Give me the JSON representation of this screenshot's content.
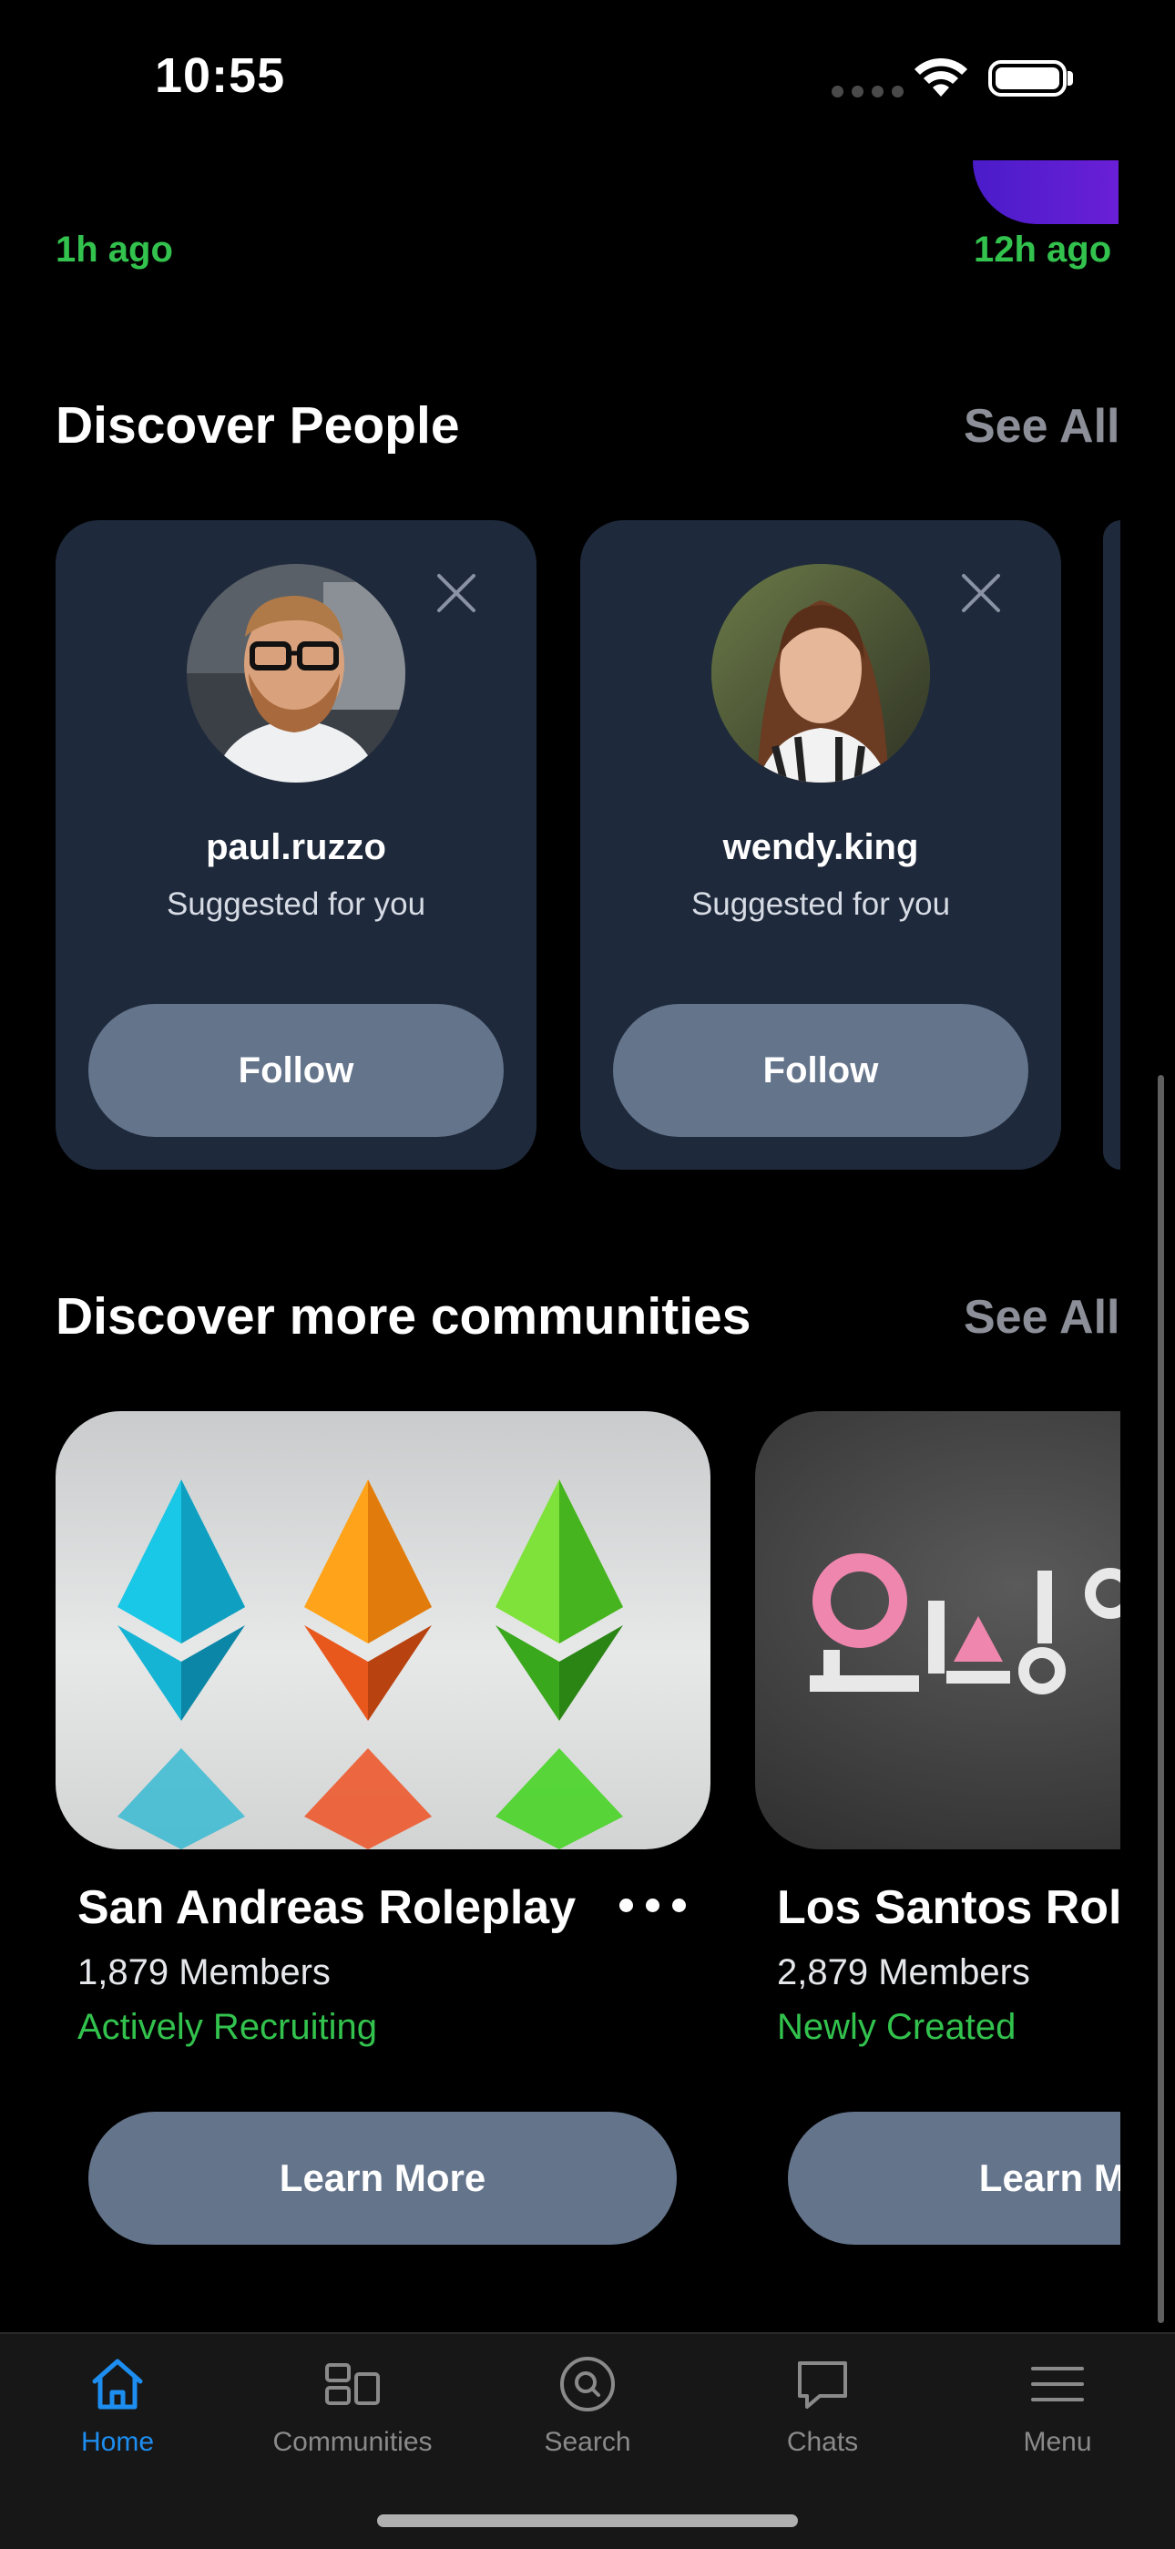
{
  "status_bar": {
    "time": "10:55"
  },
  "feed": {
    "left_time": "1h ago",
    "right_time": "12h ago"
  },
  "discover_people": {
    "title": "Discover People",
    "see_all": "See All",
    "people": [
      {
        "username": "paul.ruzzo",
        "subtitle": "Suggested for you",
        "button": "Follow"
      },
      {
        "username": "wendy.king",
        "subtitle": "Suggested for you",
        "button": "Follow"
      }
    ]
  },
  "communities": {
    "title": "Discover more communities",
    "see_all": "See All",
    "items": [
      {
        "name": "San Andreas Roleplay",
        "members": "1,879 Members",
        "status": "Actively Recruiting",
        "button": "Learn More"
      },
      {
        "name": "Los Santos Roleplay",
        "members": "2,879 Members",
        "status": "Newly Created",
        "button": "Learn More"
      }
    ]
  },
  "tabbar": {
    "tabs": [
      {
        "label": "Home",
        "icon": "home-icon",
        "active": true
      },
      {
        "label": "Communities",
        "icon": "communities-icon",
        "active": false
      },
      {
        "label": "Search",
        "icon": "search-icon",
        "active": false
      },
      {
        "label": "Chats",
        "icon": "chat-icon",
        "active": false
      },
      {
        "label": "Menu",
        "icon": "menu-icon",
        "active": false
      }
    ]
  },
  "colors": {
    "accent": "#1d8ef0",
    "success": "#32c24d",
    "card": "#1e293b",
    "button": "#64748b"
  }
}
